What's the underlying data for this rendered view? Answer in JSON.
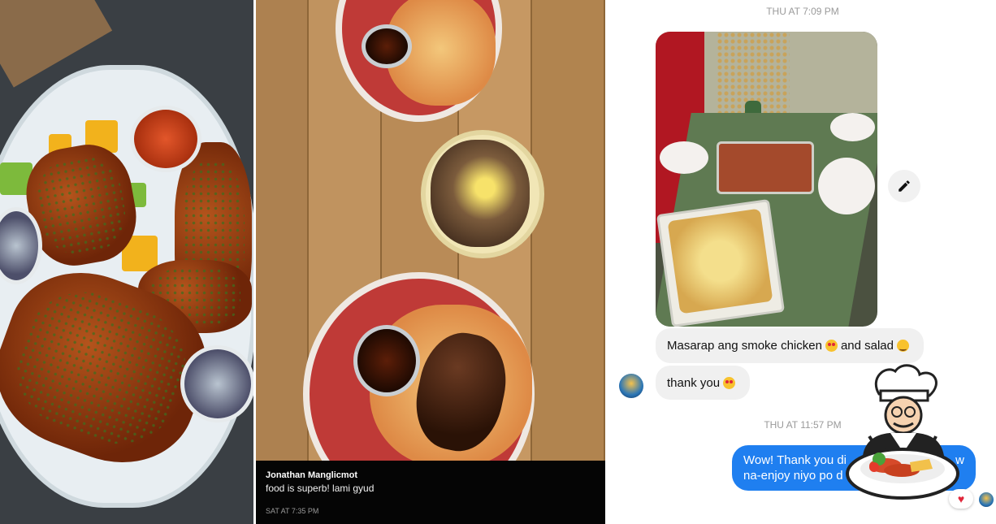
{
  "caption": {
    "name": "Jonathan Manglicmot",
    "message": "food is superb! lami gyud",
    "timestamp": "SAT AT 7:35 PM"
  },
  "chat": {
    "timestamp_1": "THU AT 7:09 PM",
    "timestamp_2": "THU AT 11:57 PM",
    "received": [
      {
        "before": "Masarap ang smoke chicken",
        "middle": "and salad",
        "emoji_1": "heart-eyes-emoji",
        "emoji_2": "blush-emoji"
      },
      {
        "before": "thank you",
        "emoji_1": "heart-eyes-emoji"
      }
    ],
    "sent": {
      "line_1": "Wow! Thank you di",
      "line_1_end": "w",
      "line_2": "na-enjoy niyo po d"
    },
    "reaction": "♥",
    "icons": [
      "pencil-icon",
      "heart-reaction-icon",
      "chef-logo-icon"
    ]
  },
  "colors": {
    "sent_bubble": "#1f7ff0",
    "received_bubble": "#f0f0f0",
    "caption_bg": "#050505"
  }
}
